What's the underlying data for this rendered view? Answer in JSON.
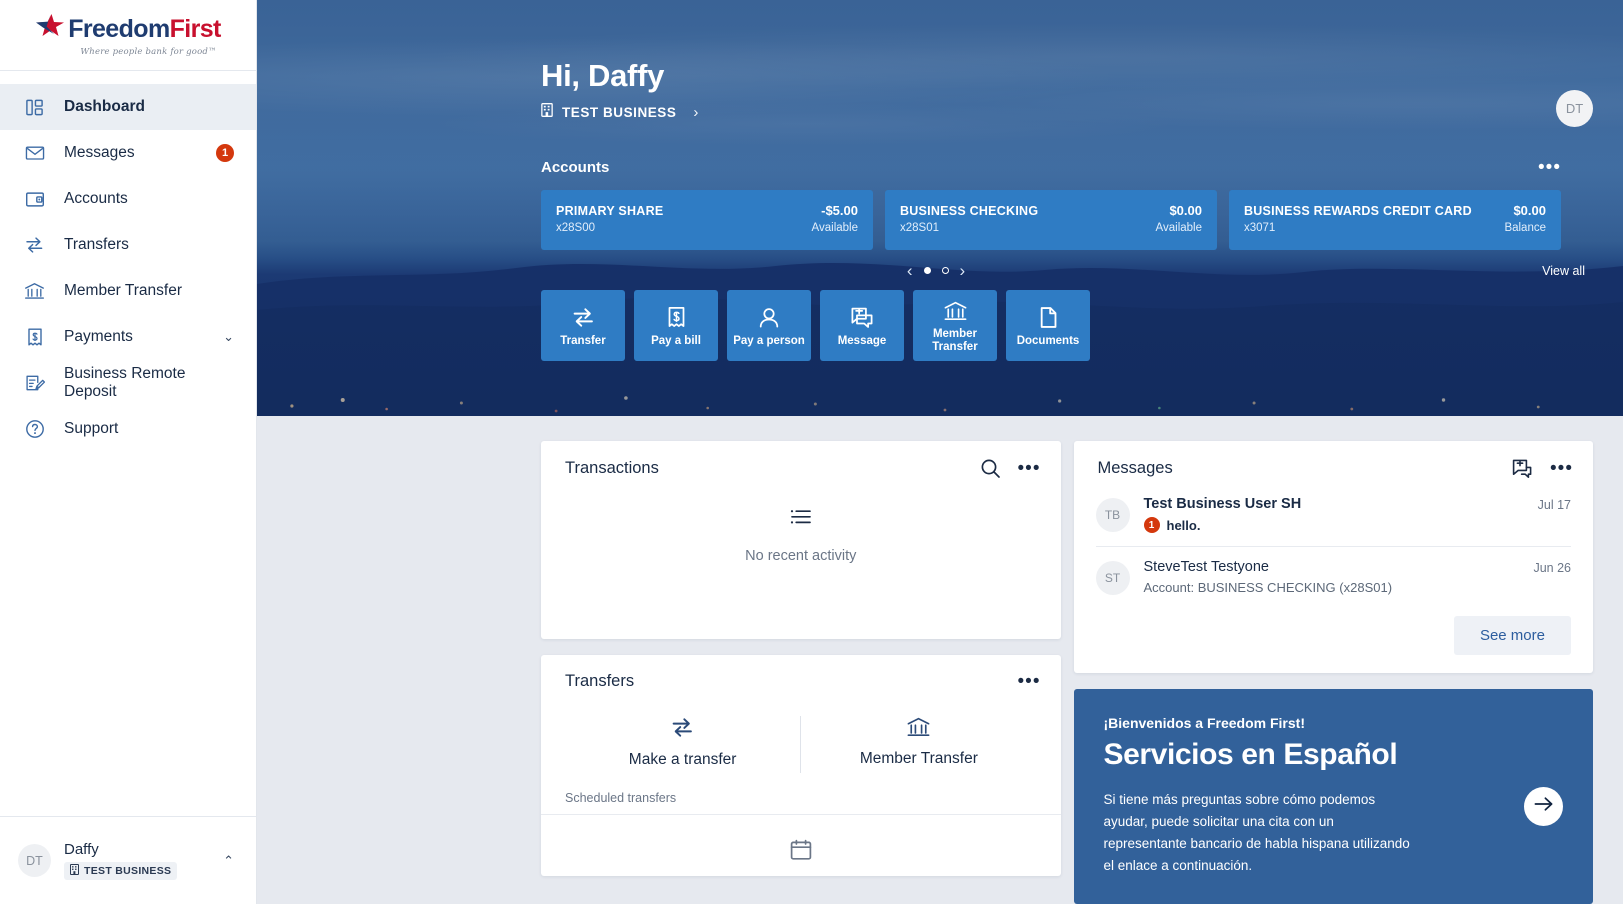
{
  "brand": {
    "name_part1": "Freedom",
    "name_part2": "First",
    "tagline": "Where people bank for good™",
    "navy": "#1f3c70",
    "red": "#c8102e",
    "accent_blue": "#2f7cc4",
    "badge_red": "#d4380d"
  },
  "sidebar": {
    "items": [
      {
        "label": "Dashboard",
        "icon": "dashboard-icon",
        "active": true
      },
      {
        "label": "Messages",
        "icon": "envelope-icon",
        "badge": "1"
      },
      {
        "label": "Accounts",
        "icon": "wallet-icon"
      },
      {
        "label": "Transfers",
        "icon": "transfer-arrows-icon"
      },
      {
        "label": "Member Transfer",
        "icon": "bank-icon"
      },
      {
        "label": "Payments",
        "icon": "receipt-dollar-icon",
        "chevron": "⌄"
      },
      {
        "label": "Business Remote Deposit",
        "icon": "deposit-check-icon"
      },
      {
        "label": "Support",
        "icon": "question-circle-icon"
      }
    ],
    "footer": {
      "initials": "DT",
      "name": "Daffy",
      "business": "TEST BUSINESS",
      "caret": "⌃"
    }
  },
  "hero": {
    "greeting": "Hi, Daffy",
    "business": "TEST BUSINESS",
    "business_chevron": "›",
    "avatar_initials": "DT"
  },
  "accounts": {
    "title": "Accounts",
    "menu_icon": "•••",
    "view_all": "View all",
    "carousel": {
      "prev": "‹",
      "next": "›",
      "active_index": 0,
      "count": 2
    },
    "cards": [
      {
        "name": "PRIMARY SHARE",
        "number": "x28S00",
        "amount": "-$5.00",
        "type": "Available"
      },
      {
        "name": "BUSINESS CHECKING",
        "number": "x28S01",
        "amount": "$0.00",
        "type": "Available"
      },
      {
        "name": "BUSINESS REWARDS CREDIT CARD",
        "number": "x3071",
        "amount": "$0.00",
        "type": "Balance"
      }
    ]
  },
  "quick_actions": [
    {
      "label": "Transfer",
      "icon": "transfer-arrows-icon"
    },
    {
      "label": "Pay a bill",
      "icon": "bill-dollar-icon"
    },
    {
      "label": "Pay a person",
      "icon": "person-icon"
    },
    {
      "label": "Message",
      "icon": "message-plus-icon"
    },
    {
      "label": "Member Transfer",
      "icon": "bank-icon"
    },
    {
      "label": "Documents",
      "icon": "document-icon"
    }
  ],
  "transactions": {
    "title": "Transactions",
    "search_icon": "search-icon",
    "menu_icon": "•••",
    "empty_text": "No recent activity",
    "empty_icon": "list-icon"
  },
  "messages": {
    "title": "Messages",
    "compose_icon": "new-message-icon",
    "menu_icon": "•••",
    "see_more": "See more",
    "items": [
      {
        "initials": "TB",
        "name": "Test Business User SH",
        "preview": "hello.",
        "badge": "1",
        "date": "Jul 17",
        "unread": true
      },
      {
        "initials": "ST",
        "name": "SteveTest Testyone",
        "preview": "Account: BUSINESS CHECKING (x28S01)",
        "badge": "",
        "date": "Jun 26",
        "unread": false
      }
    ]
  },
  "transfers": {
    "title": "Transfers",
    "menu_icon": "•••",
    "actions": [
      {
        "label": "Make a transfer",
        "icon": "transfer-arrows-icon"
      },
      {
        "label": "Member Transfer",
        "icon": "bank-icon"
      }
    ],
    "scheduled_label": "Scheduled transfers",
    "scheduled_icon": "calendar-icon"
  },
  "promo": {
    "kicker": "¡Bienvenidos a Freedom First!",
    "title": "Servicios en Español",
    "body": "Si tiene más preguntas sobre cómo podemos ayudar, puede solicitar una cita con un representante bancario de habla hispana utilizando el enlace a continuación.",
    "arrow_icon": "arrow-right-icon",
    "background": "#32619a"
  }
}
